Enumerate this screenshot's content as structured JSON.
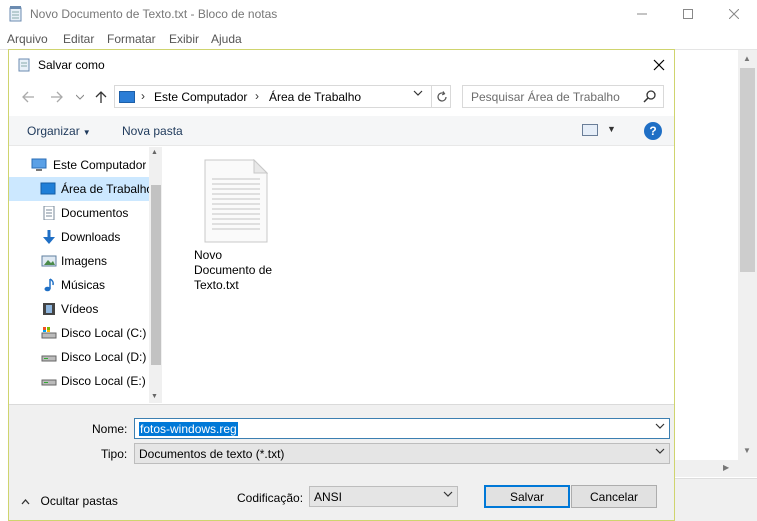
{
  "notepad": {
    "title": "Novo Documento de Texto.txt - Bloco de notas",
    "menu": [
      "Arquivo",
      "Editar",
      "Formatar",
      "Exibir",
      "Ajuda"
    ]
  },
  "dialog": {
    "title": "Salvar como",
    "breadcrumb": [
      "Este Computador",
      "Área de Trabalho"
    ],
    "search_placeholder": "Pesquisar Área de Trabalho",
    "toolbar": {
      "organize": "Organizar",
      "new_folder": "Nova pasta"
    },
    "tree": [
      {
        "label": "Este Computador",
        "icon": "computer-icon"
      },
      {
        "label": "Área de Trabalho",
        "icon": "desktop-icon",
        "selected": true
      },
      {
        "label": "Documentos",
        "icon": "documents-icon"
      },
      {
        "label": "Downloads",
        "icon": "downloads-icon"
      },
      {
        "label": "Imagens",
        "icon": "pictures-icon"
      },
      {
        "label": "Músicas",
        "icon": "music-icon"
      },
      {
        "label": "Vídeos",
        "icon": "videos-icon"
      },
      {
        "label": "Disco Local (C:)",
        "icon": "drive-c-icon"
      },
      {
        "label": "Disco Local (D:)",
        "icon": "drive-icon"
      },
      {
        "label": "Disco Local (E:)",
        "icon": "drive-icon"
      }
    ],
    "files": [
      {
        "line1": "Novo",
        "line2": "Documento de",
        "line3": "Texto.txt"
      }
    ],
    "name_label": "Nome:",
    "name_value": "fotos-windows.reg",
    "type_label": "Tipo:",
    "type_value": "Documentos de texto (*.txt)",
    "encoding_label": "Codificação:",
    "encoding_value": "ANSI",
    "hide_folders": "Ocultar pastas",
    "save_button": "Salvar",
    "cancel_button": "Cancelar"
  }
}
